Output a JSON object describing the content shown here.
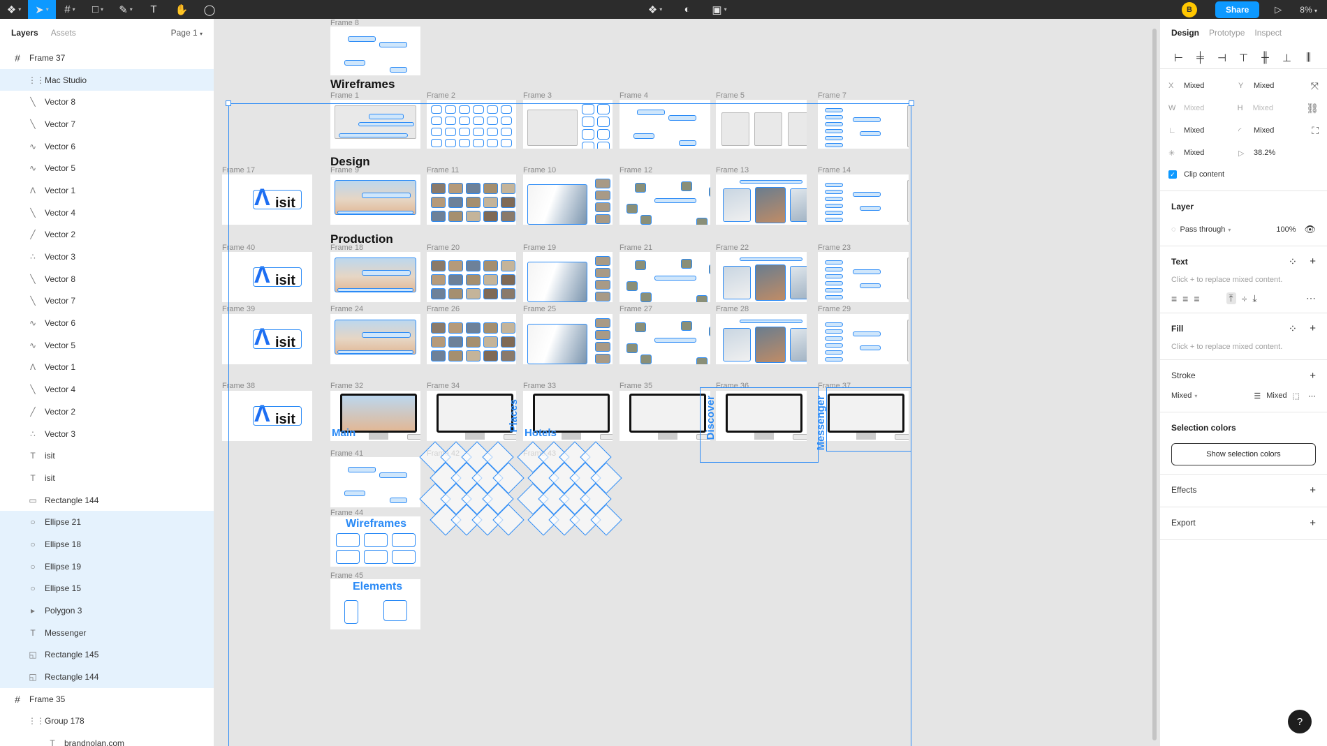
{
  "toolbar": {
    "left_icons": [
      "figma-menu-icon",
      "move-tool-icon",
      "frame-tool-icon",
      "shape-tool-icon",
      "pen-tool-icon",
      "text-tool-icon",
      "hand-tool-icon",
      "comment-tool-icon"
    ],
    "center_icons": [
      "component-icon",
      "mask-icon",
      "boolean-icon"
    ],
    "avatar_initial": "B",
    "share_label": "Share",
    "play_icon": "present-icon",
    "zoom_label": "8%"
  },
  "left_panel": {
    "tabs": [
      "Layers",
      "Assets"
    ],
    "page_label": "Page 1",
    "layers": [
      {
        "label": "Frame 37",
        "type": "frame",
        "icon": "#"
      },
      {
        "label": "Mac Studio",
        "type": "child",
        "icon": "⋮⋮",
        "selected": true
      },
      {
        "label": "Vector 8",
        "type": "child",
        "icon": "╲"
      },
      {
        "label": "Vector 7",
        "type": "child",
        "icon": "╲"
      },
      {
        "label": "Vector 6",
        "type": "child",
        "icon": "∿"
      },
      {
        "label": "Vector 5",
        "type": "child",
        "icon": "∿"
      },
      {
        "label": "Vector 1",
        "type": "child",
        "icon": "Λ"
      },
      {
        "label": "Vector 4",
        "type": "child",
        "icon": "╲"
      },
      {
        "label": "Vector 2",
        "type": "child",
        "icon": "╱"
      },
      {
        "label": "Vector 3",
        "type": "child",
        "icon": "∴"
      },
      {
        "label": "Vector 8",
        "type": "child",
        "icon": "╲"
      },
      {
        "label": "Vector 7",
        "type": "child",
        "icon": "╲"
      },
      {
        "label": "Vector 6",
        "type": "child",
        "icon": "∿"
      },
      {
        "label": "Vector 5",
        "type": "child",
        "icon": "∿"
      },
      {
        "label": "Vector 1",
        "type": "child",
        "icon": "Λ"
      },
      {
        "label": "Vector 4",
        "type": "child",
        "icon": "╲"
      },
      {
        "label": "Vector 2",
        "type": "child",
        "icon": "╱"
      },
      {
        "label": "Vector 3",
        "type": "child",
        "icon": "∴"
      },
      {
        "label": "isit",
        "type": "child",
        "icon": "T"
      },
      {
        "label": "isit",
        "type": "child",
        "icon": "T"
      },
      {
        "label": "Rectangle 144",
        "type": "child",
        "icon": "▭"
      },
      {
        "label": "Ellipse 21",
        "type": "child",
        "icon": "○",
        "selected": true
      },
      {
        "label": "Ellipse 18",
        "type": "child",
        "icon": "○",
        "selected": true
      },
      {
        "label": "Ellipse 19",
        "type": "child",
        "icon": "○",
        "selected": true
      },
      {
        "label": "Ellipse 15",
        "type": "child",
        "icon": "○",
        "selected": true
      },
      {
        "label": "Polygon 3",
        "type": "child",
        "icon": "▸",
        "selected": true
      },
      {
        "label": "Messenger",
        "type": "child",
        "icon": "T",
        "selected": true
      },
      {
        "label": "Rectangle 145",
        "type": "child",
        "icon": "◱",
        "selected": true
      },
      {
        "label": "Rectangle 144",
        "type": "child",
        "icon": "◱",
        "selected": true
      },
      {
        "label": "Frame 35",
        "type": "frame",
        "icon": "#"
      },
      {
        "label": "Group 178",
        "type": "child",
        "icon": "⋮⋮"
      },
      {
        "label": "brandnolan.com",
        "type": "child2",
        "icon": "T"
      }
    ]
  },
  "canvas": {
    "sections": {
      "wireframes": "Wireframes",
      "design": "Design",
      "production": "Production"
    },
    "frame_labels": {
      "f8": "Frame 8",
      "f1": "Frame 1",
      "f2": "Frame 2",
      "f3": "Frame 3",
      "f4": "Frame 4",
      "f5": "Frame 5",
      "f7": "Frame 7",
      "f17": "Frame 17",
      "f9": "Frame 9",
      "f11": "Frame 11",
      "f10": "Frame 10",
      "f12": "Frame 12",
      "f13": "Frame 13",
      "f14": "Frame 14",
      "f40": "Frame 40",
      "f18": "Frame 18",
      "f20": "Frame 20",
      "f19": "Frame 19",
      "f21": "Frame 21",
      "f22": "Frame 22",
      "f23": "Frame 23",
      "f39": "Frame 39",
      "f24": "Frame 24",
      "f26": "Frame 26",
      "f25": "Frame 25",
      "f27": "Frame 27",
      "f28": "Frame 28",
      "f29": "Frame 29",
      "f38": "Frame 38",
      "f32": "Frame 32",
      "f34": "Frame 34",
      "f33": "Frame 33",
      "f35": "Frame 35",
      "f36": "Frame 36",
      "f37": "Frame 37",
      "f41": "Frame 41",
      "f42": "Frame 42",
      "f43": "Frame 43",
      "f44": "Frame 44",
      "f45": "Frame 45"
    },
    "thumb_text": {
      "logo_a": "Λ",
      "logo_isit": "isit",
      "wireframes_art": "Wireframes",
      "elements_art": "Elements",
      "main_label": "Main",
      "places_label": "Places",
      "hotels_label": "Hotels",
      "discover_label": "Discover",
      "messenger_label": "Messenger"
    }
  },
  "right_panel": {
    "tabs": [
      "Design",
      "Prototype",
      "Inspect"
    ],
    "props": {
      "x": {
        "label": "X",
        "value": "Mixed"
      },
      "y": {
        "label": "Y",
        "value": "Mixed"
      },
      "w": {
        "label": "W",
        "value": "Mixed"
      },
      "h": {
        "label": "H",
        "value": "Mixed"
      },
      "rotation": {
        "label": "∟",
        "value": "Mixed"
      },
      "radius": {
        "label": "◜",
        "value": "Mixed"
      },
      "independent": {
        "label": "✳",
        "value": "Mixed"
      },
      "skew": {
        "label": "▷",
        "value": "38.2%"
      }
    },
    "clip_content": "Clip content",
    "layer_title": "Layer",
    "blend_mode": "Pass through",
    "opacity": "100%",
    "text_title": "Text",
    "text_hint": "Click + to replace mixed content.",
    "fill_title": "Fill",
    "fill_hint": "Click + to replace mixed content.",
    "stroke_title": "Stroke",
    "stroke_value": "Mixed",
    "stroke_weight": "Mixed",
    "selection_colors_title": "Selection colors",
    "show_selection_colors": "Show selection colors",
    "effects_title": "Effects",
    "export_title": "Export",
    "help": "?"
  }
}
